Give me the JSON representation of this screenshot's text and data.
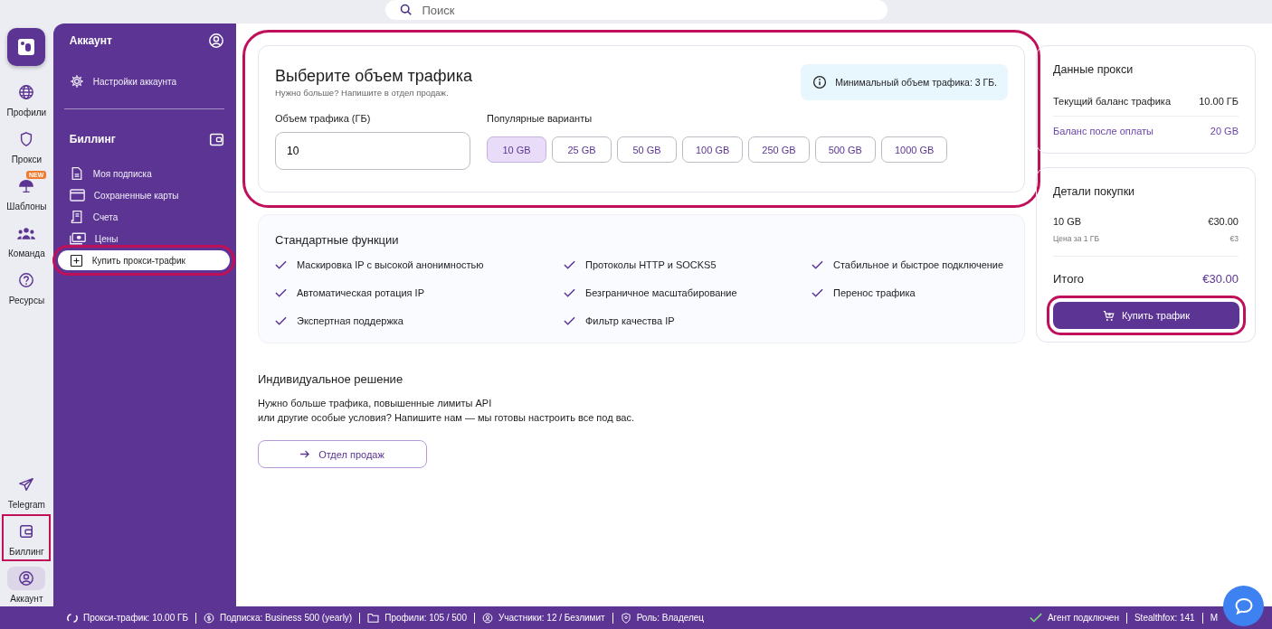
{
  "search": {
    "placeholder": "Поиск"
  },
  "rail": {
    "items": [
      {
        "label": "Профили",
        "kind": "globe",
        "selected": false,
        "highlighted": false
      },
      {
        "label": "Прокси",
        "kind": "shield",
        "selected": false,
        "highlighted": false
      },
      {
        "label": "Шаблоны",
        "kind": "umbrella",
        "badge": "NEW",
        "selected": false,
        "highlighted": false
      },
      {
        "label": "Команда",
        "kind": "team",
        "selected": false,
        "highlighted": false
      },
      {
        "label": "Ресурсы",
        "kind": "help",
        "selected": false,
        "highlighted": false
      }
    ],
    "bottom_items": [
      {
        "label": "Telegram",
        "kind": "plane",
        "selected": false,
        "highlighted": false
      },
      {
        "label": "Биллинг",
        "kind": "wallet",
        "selected": false,
        "highlighted": true
      },
      {
        "label": "Аккаунт",
        "kind": "user",
        "selected": true,
        "highlighted": false
      }
    ]
  },
  "sidebar": {
    "sections": [
      {
        "title": "Аккаунт",
        "kind": "user",
        "items": [
          {
            "label": "Настройки аккаунта",
            "kind": "gear",
            "selected": false,
            "highlighted": false
          }
        ]
      },
      {
        "title": "Биллинг",
        "kind": "wallet",
        "items": [
          {
            "label": "Моя подписка",
            "kind": "doc",
            "selected": false,
            "highlighted": false
          },
          {
            "label": "Сохраненные карты",
            "kind": "card",
            "selected": false,
            "highlighted": false
          },
          {
            "label": "Счета",
            "kind": "receipt",
            "selected": false,
            "highlighted": false
          },
          {
            "label": "Цены",
            "kind": "cash",
            "selected": false,
            "highlighted": false
          },
          {
            "label": "Купить прокси-трафик",
            "kind": "plus",
            "selected": true,
            "highlighted": true
          }
        ]
      }
    ]
  },
  "traffic": {
    "title": "Выберите объем трафика",
    "subtitle": "Нужно больше? Напишите в отдел продаж.",
    "notice": "Минимальный объем трафика: 3 ГБ.",
    "field_label": "Объем трафика (ГБ)",
    "value": "10",
    "presets_label": "Популярные варианты",
    "highlighted": true,
    "presets": [
      {
        "label": "10 GB",
        "selected": true
      },
      {
        "label": "25 GB",
        "selected": false
      },
      {
        "label": "50 GB",
        "selected": false
      },
      {
        "label": "100 GB",
        "selected": false
      },
      {
        "label": "250 GB",
        "selected": false
      },
      {
        "label": "500 GB",
        "selected": false
      },
      {
        "label": "1000 GB",
        "selected": false
      }
    ]
  },
  "features": {
    "title": "Стандартные функции",
    "items": [
      "Маскировка IP с высокой анонимностью",
      "Протоколы HTTP и SOCKS5",
      "Стабильное и быстрое подключение",
      "Автоматическая ротация IP",
      "Безграничное масштабирование",
      "Перенос трафика",
      "Экспертная поддержка",
      "Фильтр качества IP"
    ]
  },
  "custom": {
    "title": "Индивидуальное решение",
    "lines": [
      "Нужно больше трафика, повышенные лимиты API",
      "или другие особые условия? Напишите нам — мы готовы настроить все под вас."
    ],
    "button": "Отдел продаж"
  },
  "proxy_data": {
    "title": "Данные прокси",
    "rows": [
      {
        "label": "Текущий баланс трафика",
        "value": "10.00 ГБ",
        "kind": "plain"
      },
      {
        "label": "Баланс после оплаты",
        "value": "20 GB",
        "kind": "accent"
      }
    ]
  },
  "purchase": {
    "title": "Детали покупки",
    "item_label": "10 GB",
    "item_value": "€30.00",
    "unit_label": "Цена за 1 ГБ",
    "unit_value": "€3",
    "total_label": "Итого",
    "total": "€30.00",
    "button": "Купить трафик",
    "highlighted": true
  },
  "status_bar": {
    "items": [
      {
        "kind": "sync",
        "text": "Прокси-трафик: 10.00 ГБ"
      },
      {
        "kind": "coin",
        "text": "Подписка: Business 500 (yearly)"
      },
      {
        "kind": "folder",
        "text": "Профили: 105 / 500"
      },
      {
        "kind": "user",
        "text": "Участники: 12 / Безлимит"
      },
      {
        "kind": "shield",
        "text": "Роль: Владелец"
      }
    ],
    "right": [
      {
        "kind": "check",
        "text": "Агент подключен"
      },
      {
        "kind": "none",
        "text": "Stealthfox: 141"
      },
      {
        "kind": "none",
        "text": "M"
      }
    ]
  }
}
